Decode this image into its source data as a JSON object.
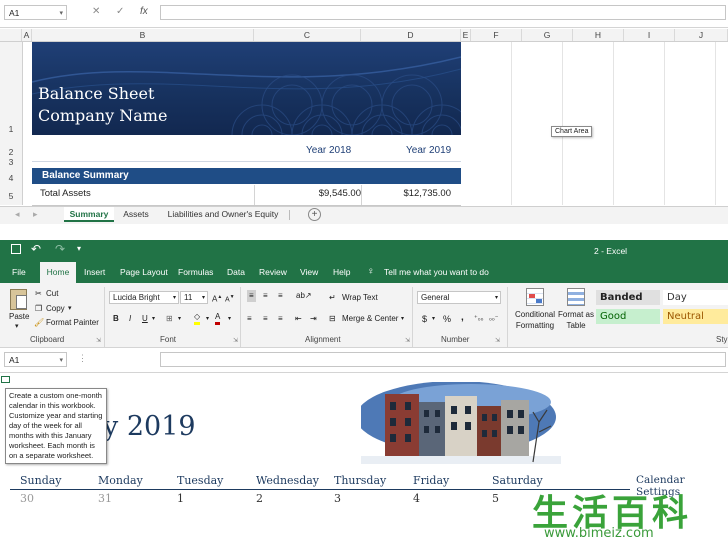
{
  "top": {
    "namebox": "A1",
    "formula_icons": [
      "✕",
      "✓",
      "fx"
    ],
    "columns": [
      "A",
      "B",
      "C",
      "D",
      "E",
      "F",
      "G",
      "H",
      "I",
      "J"
    ],
    "rows": [
      "1",
      "2",
      "3",
      "4",
      "5"
    ],
    "banner": {
      "title": "Balance Sheet",
      "subtitle": "Company Name"
    },
    "year_labels": [
      "Year 2018",
      "Year 2019"
    ],
    "summary_title": "Balance Summary",
    "total_assets": {
      "label": "Total Assets",
      "y2018": "$9,545.00",
      "y2019": "$12,735.00"
    },
    "chart_area_tip": "Chart Area",
    "sheet_tabs": [
      "Summary",
      "Assets",
      "Liabilities and Owner's Equity"
    ],
    "add_sheet_symbol": "+"
  },
  "titlebar": {
    "title": "2  -  Excel"
  },
  "ribbon": {
    "tabs": [
      "File",
      "Home",
      "Insert",
      "Page Layout",
      "Formulas",
      "Data",
      "Review",
      "View",
      "Help"
    ],
    "tell_me": "Tell me what you want to do",
    "clipboard": {
      "paste": "Paste",
      "cut": "Cut",
      "copy": "Copy",
      "format_painter": "Format Painter",
      "label": "Clipboard"
    },
    "font": {
      "name": "Lucida Bright",
      "size": "11",
      "bold": "B",
      "italic": "I",
      "underline": "U",
      "label": "Font"
    },
    "alignment": {
      "wrap": "Wrap Text",
      "merge": "Merge & Center",
      "label": "Alignment"
    },
    "number": {
      "format": "General",
      "currency": "$",
      "percent": "%",
      "comma": ",",
      "label": "Number"
    },
    "styles": {
      "conditional": "Conditional Formatting",
      "format_table": "Format as Table",
      "cells": [
        {
          "text": "Banded",
          "bg": "#e0e0e0",
          "fg": "#222222"
        },
        {
          "text": "Day",
          "bg": "#ffffff",
          "fg": "#333333"
        },
        {
          "text": "Good",
          "bg": "#c6efce",
          "fg": "#006100"
        },
        {
          "text": "Neutral",
          "bg": "#ffeb9c",
          "fg": "#9c5700"
        }
      ],
      "label": "Sty"
    }
  },
  "bottom": {
    "namebox": "A1",
    "month_title": "y 2019",
    "tooltip": "Create a custom one-month calendar in this workbook. Customize year and starting day of the week for all months with this January worksheet. Each month is on a separate worksheet.",
    "calendar_settings": "Calendar Settings",
    "days": [
      "Sunday",
      "Monday",
      "Tuesday",
      "Wednesday",
      "Thursday",
      "Friday",
      "Saturday"
    ],
    "dates": [
      "30",
      "31",
      "1",
      "2",
      "3",
      "4",
      "5"
    ]
  },
  "watermark": {
    "chars": "生活百科",
    "url": "www.bimeiz.com"
  },
  "colors": {
    "excel_green": "#217346",
    "banner_blue": "#1f3f76",
    "summary_blue": "#1f4d86"
  }
}
